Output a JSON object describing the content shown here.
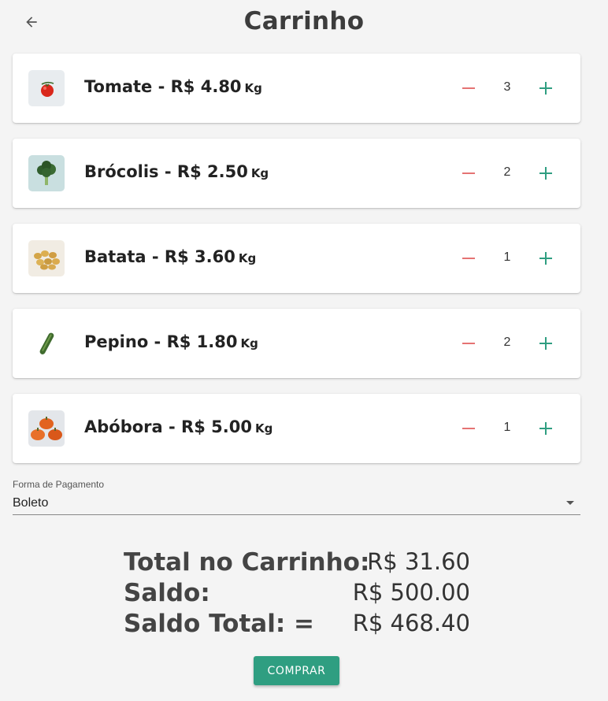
{
  "header": {
    "title": "Carrinho",
    "back_icon": "arrow-left-icon"
  },
  "items": [
    {
      "name": "Tomate - R$ 4.80",
      "unit": "Kg",
      "qty": "3",
      "image": "tomato"
    },
    {
      "name": "Brócolis - R$ 2.50",
      "unit": "Kg",
      "qty": "2",
      "image": "broccoli"
    },
    {
      "name": "Batata - R$ 3.60",
      "unit": "Kg",
      "qty": "1",
      "image": "potato"
    },
    {
      "name": "Pepino - R$ 1.80",
      "unit": "Kg",
      "qty": "2",
      "image": "cucumber"
    },
    {
      "name": "Abóbora - R$ 5.00",
      "unit": "Kg",
      "qty": "1",
      "image": "pumpkin"
    }
  ],
  "payment": {
    "label": "Forma de Pagamento",
    "selected": "Boleto"
  },
  "totals": {
    "cart_label": "Total no Carrinho:",
    "cart_value": "R$ 31.60",
    "balance_label": "Saldo:",
    "balance_value": "R$ 500.00",
    "final_label": "Saldo Total: =",
    "final_value": "R$ 468.40"
  },
  "actions": {
    "buy_label": "COMPRAR"
  },
  "colors": {
    "minus": "#e57373",
    "plus": "#2f9e81",
    "button": "#2f9e81"
  }
}
